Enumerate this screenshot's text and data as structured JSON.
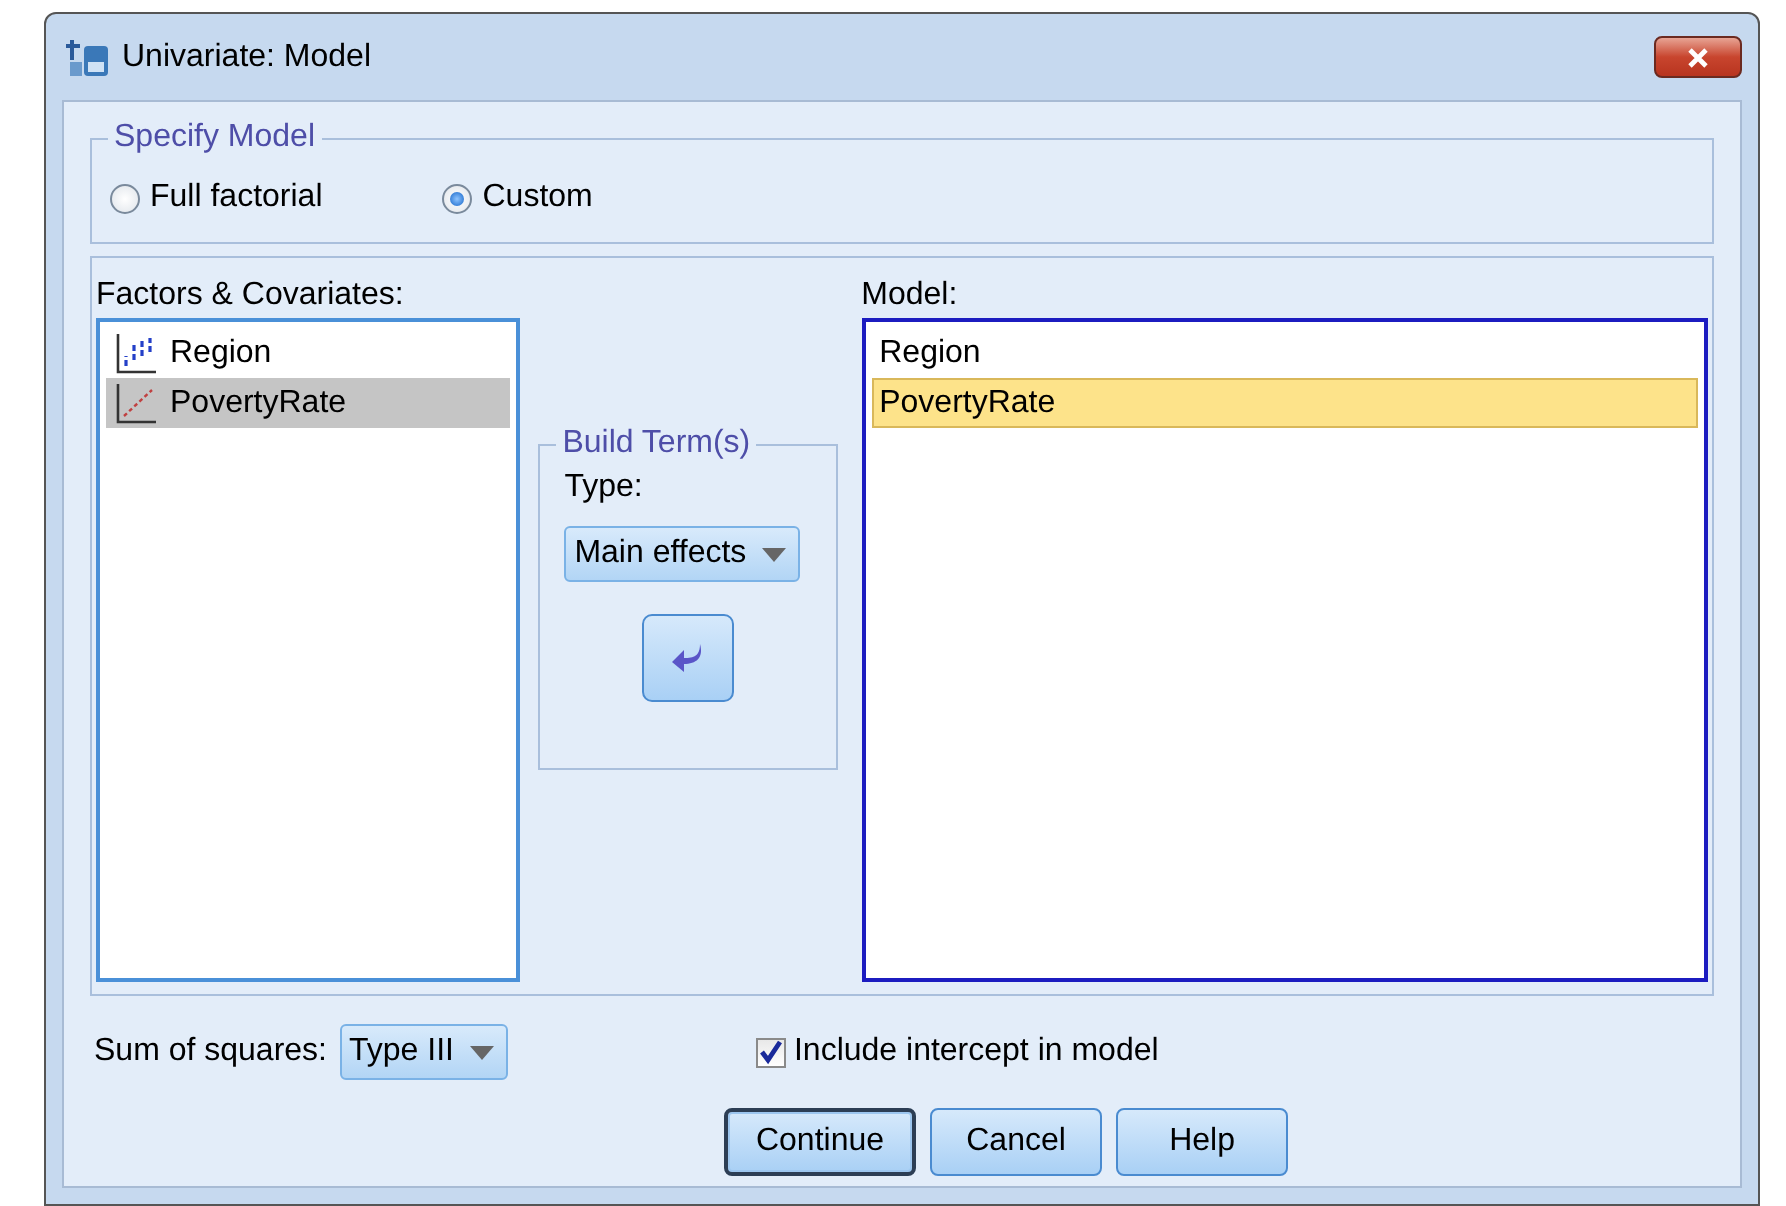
{
  "window": {
    "title": "Univariate: Model"
  },
  "specify_model": {
    "legend": "Specify Model",
    "options": [
      {
        "label": "Full factorial",
        "selected": false
      },
      {
        "label": "Custom",
        "selected": true
      }
    ]
  },
  "factors_covariates": {
    "label": "Factors & Covariates:",
    "items": [
      {
        "label": "Region",
        "kind": "nominal",
        "selected": false
      },
      {
        "label": "PovertyRate",
        "kind": "scale",
        "selected": true
      }
    ]
  },
  "build_terms": {
    "legend": "Build Term(s)",
    "type_label": "Type:",
    "type_value": "Main effects"
  },
  "model": {
    "label": "Model:",
    "items": [
      {
        "label": "Region",
        "selected": false
      },
      {
        "label": "PovertyRate",
        "selected": true
      }
    ]
  },
  "sum_of_squares": {
    "label": "Sum of squares:",
    "value": "Type III"
  },
  "include_intercept": {
    "label": "Include intercept in model",
    "checked": true
  },
  "buttons": [
    {
      "label": "Continue",
      "default": true
    },
    {
      "label": "Cancel",
      "default": false
    },
    {
      "label": "Help",
      "default": false
    }
  ]
}
